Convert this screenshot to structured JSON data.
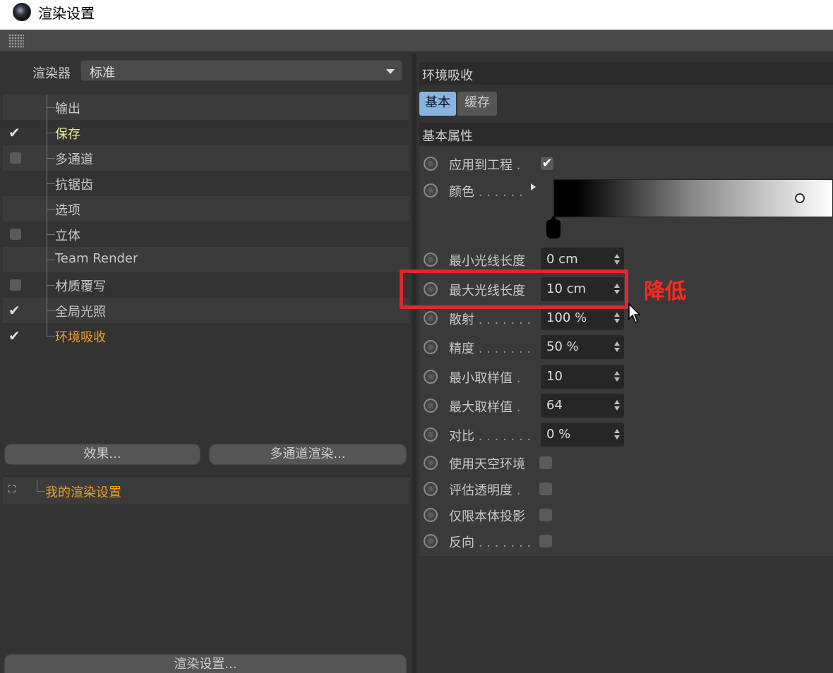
{
  "window": {
    "title": "渲染设置"
  },
  "renderer": {
    "label": "渲染器",
    "value": "标准"
  },
  "tree": [
    {
      "label": "输出",
      "state": "none",
      "color": "normal"
    },
    {
      "label": "保存",
      "state": "checked",
      "color": "yellow"
    },
    {
      "label": "多通道",
      "state": "box",
      "color": "normal"
    },
    {
      "label": "抗锯齿",
      "state": "none",
      "color": "normal"
    },
    {
      "label": "选项",
      "state": "none",
      "color": "normal"
    },
    {
      "label": "立体",
      "state": "box",
      "color": "normal"
    },
    {
      "label": "Team Render",
      "state": "none",
      "color": "normal"
    },
    {
      "label": "材质覆写",
      "state": "box",
      "color": "normal"
    },
    {
      "label": "全局光照",
      "state": "checked",
      "color": "normal"
    },
    {
      "label": "环境吸收",
      "state": "checked",
      "color": "orange"
    }
  ],
  "buttons": {
    "effects": "效果...",
    "multipass_render": "多通道渲染...",
    "render_settings": "渲染设置..."
  },
  "presets": {
    "item": "我的渲染设置"
  },
  "panel": {
    "title": "环境吸收",
    "tabs": [
      {
        "label": "基本",
        "active": true
      },
      {
        "label": "缓存",
        "active": false
      }
    ],
    "section": "基本属性",
    "apply_to_project": {
      "label": "应用到工程",
      "dots": " .",
      "checked": true
    },
    "color": {
      "label": "颜色",
      "dots": " . . . . . ."
    },
    "fields": [
      {
        "label": "最小光线长度",
        "dots": "",
        "value": "0 cm"
      },
      {
        "label": "最大光线长度",
        "dots": "",
        "value": "10 cm"
      },
      {
        "label": "散射",
        "dots": " . . . . . . .",
        "value": "100 %"
      },
      {
        "label": "精度",
        "dots": " . . . . . . .",
        "value": "50 %"
      },
      {
        "label": "最小取样值",
        "dots": " .",
        "value": "10"
      },
      {
        "label": "最大取样值",
        "dots": " .",
        "value": "64"
      },
      {
        "label": "对比",
        "dots": " . . . . . . .",
        "value": "0 %"
      }
    ],
    "checks": [
      {
        "label": "使用天空环境",
        "dots": "",
        "checked": false
      },
      {
        "label": "评估透明度",
        "dots": " .",
        "checked": false
      },
      {
        "label": "仅限本体投影",
        "dots": "",
        "checked": false
      },
      {
        "label": "反向",
        "dots": " . . . . . . .",
        "checked": false
      }
    ]
  },
  "annotation": {
    "text": "降低",
    "color": "#ff2a1f"
  }
}
